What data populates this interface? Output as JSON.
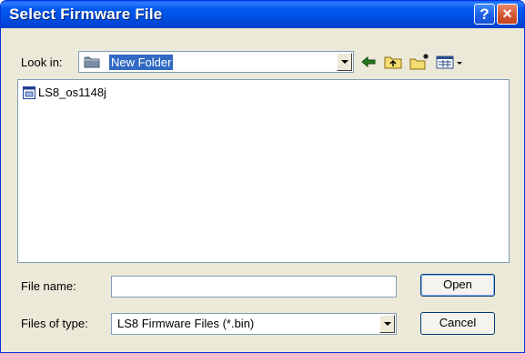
{
  "window": {
    "title": "Select Firmware File"
  },
  "titlebar": {
    "help_icon": "?",
    "close_icon": "×"
  },
  "lookin": {
    "label": "Look in:",
    "value": "New Folder"
  },
  "toolbar": {
    "icons": [
      "back-arrow-icon",
      "up-folder-icon",
      "new-folder-icon",
      "view-menu-icon"
    ],
    "accent": "#316ac5"
  },
  "files": [
    {
      "name": "LS8_os1148j",
      "icon": "binary-file-icon"
    }
  ],
  "filename": {
    "label": "File name:",
    "value": ""
  },
  "filetype": {
    "label": "Files of type:",
    "value": "LS8 Firmware Files (*.bin)"
  },
  "buttons": {
    "open": "Open",
    "cancel": "Cancel"
  }
}
